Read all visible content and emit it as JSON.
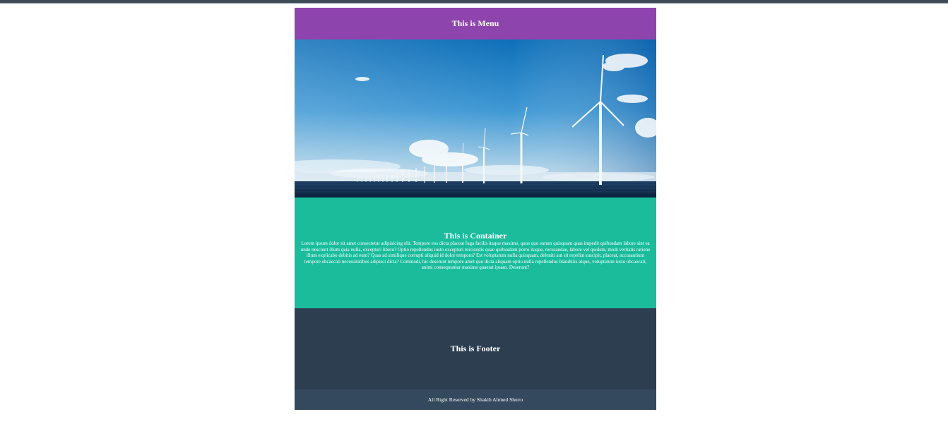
{
  "menu": {
    "title": "This is Menu"
  },
  "hero": {
    "alt": "wind-turbines-banner"
  },
  "container": {
    "title": "This is Container",
    "body": "Lorem ipsum dolor sit amet consectetur adipisicing elit. Tempore eos dicta placeat fuga facilis itaque maxime, quos quo earum quisquam quas impedit quibusdam labore sint ea unde nesciunt illum quia nulla, excepturi libero? Optio repellendus iusto excepturi reiciendis quae quibusdam porro itaque, recusandae, labore vel quidem, modi veritatis ratione illum explicabo debitis ad eum? Quas ad similique corrupti aliquid id dolor tempora? Est voluptatum nulla quisquam, deleniti aut sit repellat suscipit, placeat, accusantium tempore obcaecati necessitatibus adipisci dicta? Commodi, hic deserunt tempore amet quo dicta aliquam optio nulla repellendus blanditiis atque, voluptatum iusto obcaecati, animi consequuntur maxime quaerat ipsam. Deserunt?"
  },
  "footer": {
    "title": "This is Footer",
    "copyright": "All Right Reserved by Shakib Ahmed Shuvo"
  },
  "colors": {
    "menu": "#8e44ad",
    "container": "#1abc9c",
    "footer": "#2c3e50",
    "copyright": "#34495e"
  }
}
